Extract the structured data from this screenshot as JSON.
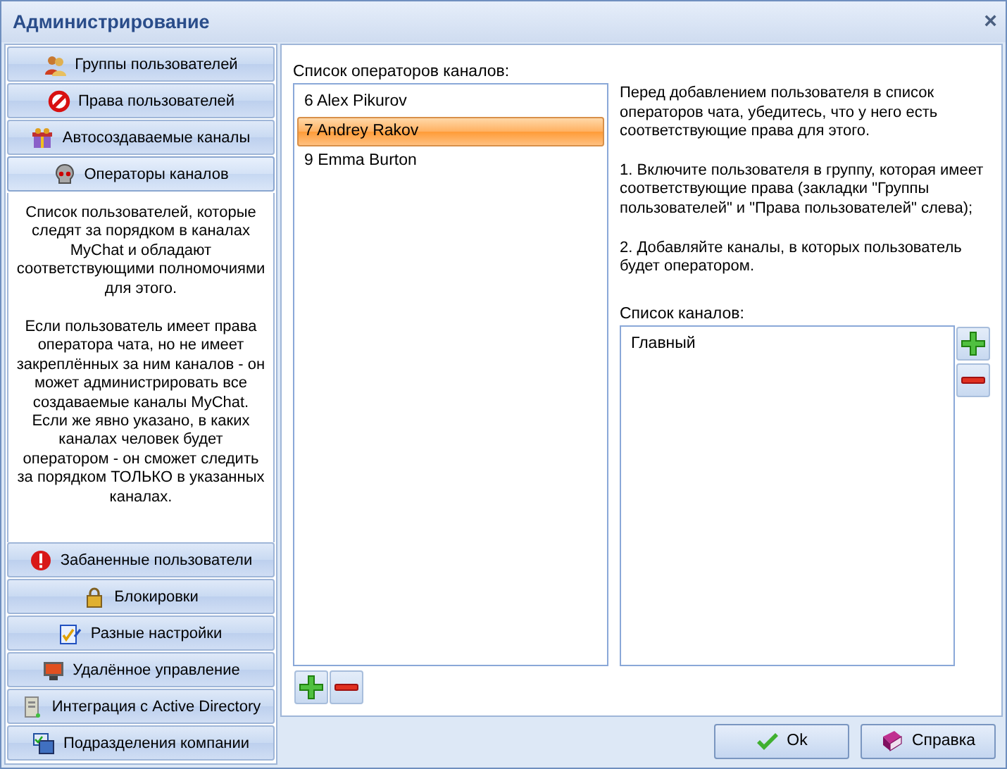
{
  "window": {
    "title": "Администрирование",
    "close": "×"
  },
  "sections": [
    {
      "label": "Группы пользователей",
      "selected": false
    },
    {
      "label": "Права пользователей",
      "selected": false
    },
    {
      "label": "Автосоздаваемые каналы",
      "selected": false
    },
    {
      "label": "Операторы каналов",
      "selected": true
    },
    {
      "label": "Забаненные пользователи",
      "selected": false
    },
    {
      "label": "Блокировки",
      "selected": false
    },
    {
      "label": "Разные настройки",
      "selected": false
    },
    {
      "label": "Удалённое управление",
      "selected": false
    },
    {
      "label": "Интеграция с Active Directory",
      "selected": false
    },
    {
      "label": "Подразделения компании",
      "selected": false
    }
  ],
  "section_description": [
    "Список пользователей, которые следят за порядком в каналах MyChat и обладают соответствующими полномочиями для этого.",
    "Если пользователь имеет права оператора чата, но не имеет закреплённых за ним каналов - он может администрировать все создаваемые каналы MyChat. Если же явно указано, в каких каналах человек будет оператором - он сможет следить за порядком ТОЛЬКО в указанных каналах."
  ],
  "operators": {
    "label": "Список операторов каналов:",
    "items": [
      {
        "text": "6 Alex Pikurov",
        "selected": false
      },
      {
        "text": "7 Andrey Rakov",
        "selected": true
      },
      {
        "text": "9 Emma Burton",
        "selected": false
      }
    ]
  },
  "help_text": [
    "Перед добавлением пользователя в список операторов чата, убедитесь, что у него есть соответствующие права для этого.",
    "1. Включите пользователя в группу, которая имеет соответствующие права (закладки \"Группы пользователей\" и \"Права пользователей\" слева);",
    "2. Добавляйте каналы, в которых пользователь будет оператором."
  ],
  "channels": {
    "label": "Список каналов:",
    "items": [
      {
        "text": "Главный",
        "selected": false
      }
    ]
  },
  "buttons": [
    {
      "label": "Ok"
    },
    {
      "label": "Справка"
    }
  ]
}
